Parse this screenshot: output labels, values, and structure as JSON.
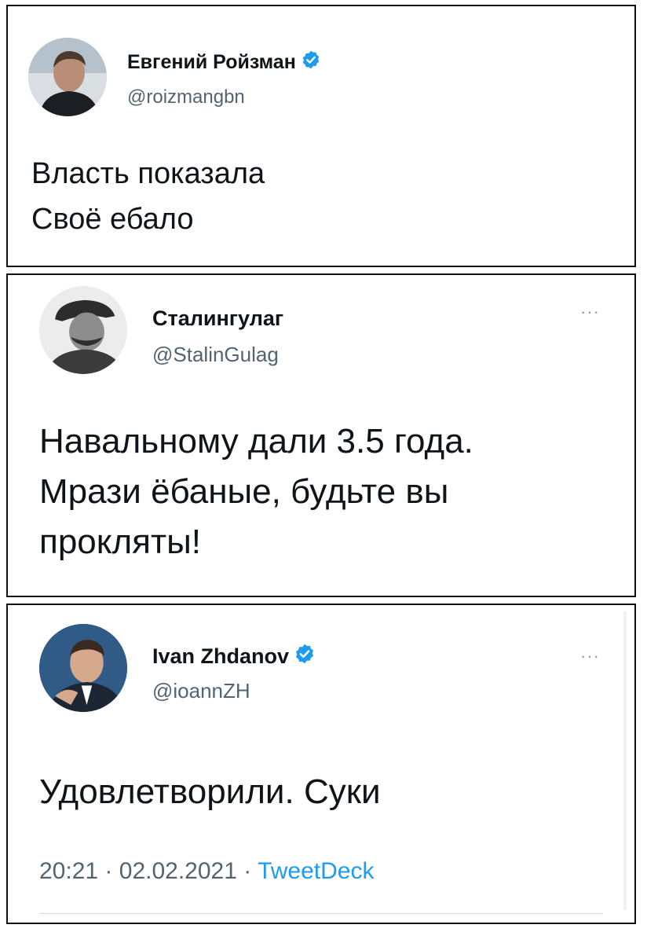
{
  "accent_color": "#1d9bf0",
  "tweets": [
    {
      "name": "Евгений Ройзман",
      "handle": "@roizmangbn",
      "verified": true,
      "avatar_icon": "avatar-photo",
      "text_lines": [
        "Власть показала",
        "Своё ебало"
      ]
    },
    {
      "name": "Сталингулаг",
      "handle": "@StalinGulag",
      "verified": false,
      "more_icon": "more-horizontal-icon",
      "avatar_icon": "avatar-photo",
      "text_lines": [
        "Навальному дали 3.5 года.",
        "Мрази ёбаные, будьте вы",
        "прокляты!"
      ]
    },
    {
      "name": "Ivan Zhdanov",
      "handle": "@ioannZH",
      "verified": true,
      "more_icon": "more-horizontal-icon",
      "avatar_icon": "avatar-photo",
      "text_lines": [
        "Удовлетворили. Суки"
      ],
      "time": "20:21",
      "date": "02.02.2021",
      "source": "TweetDeck",
      "separator": "·"
    }
  ]
}
